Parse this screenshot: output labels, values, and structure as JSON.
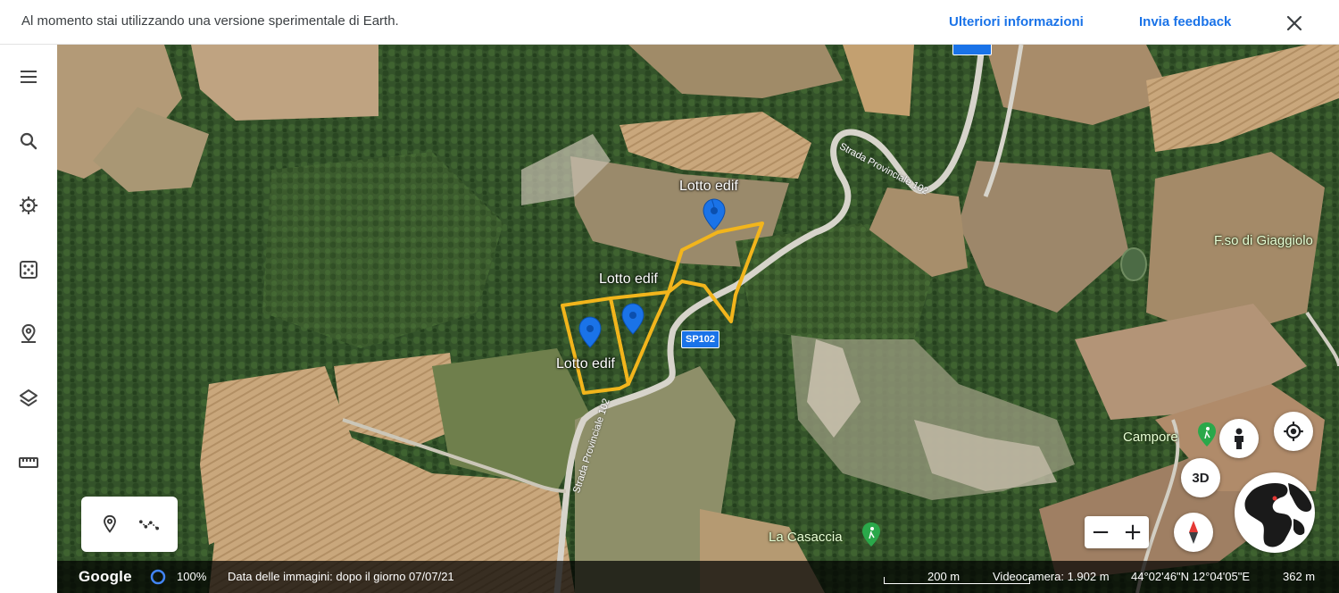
{
  "banner": {
    "message": "Al momento stai utilizzando una versione sperimentale di Earth.",
    "learn_more": "Ulteriori informazioni",
    "feedback": "Invia feedback",
    "close_icon": "close-icon"
  },
  "rail": {
    "items": [
      {
        "name": "menu-icon"
      },
      {
        "name": "search-icon"
      },
      {
        "name": "voyager-icon"
      },
      {
        "name": "feeling-lucky-dice-icon"
      },
      {
        "name": "projects-pin-icon"
      },
      {
        "name": "map-style-layers-icon"
      },
      {
        "name": "measure-ruler-icon"
      }
    ]
  },
  "map": {
    "placemarks": [
      {
        "label": "Lotto edif"
      },
      {
        "label": "Lotto edif"
      },
      {
        "label": "Lotto edif"
      }
    ],
    "places": {
      "giaggiolo": "F.so di Giaggiolo",
      "campore": "Campore",
      "casaccia": "La Casaccia"
    },
    "roads": {
      "sp102_badge": "SP102",
      "strada_label": "Strada Provinciale 102"
    },
    "polygon_color": "#f2b51c",
    "pin_color": "#1a73e8"
  },
  "controls": {
    "btn_3d": "3D",
    "zoom_out": "−",
    "zoom_in": "+"
  },
  "status": {
    "brand": "Google",
    "load_percent": "100%",
    "imagery_date": "Data delle immagini: dopo il giorno 07/07/21",
    "scale": "200 m",
    "camera": "Videocamera: 1.902 m",
    "coordinates": "44°02'46\"N 12°04'05\"E",
    "elevation": "362 m"
  }
}
